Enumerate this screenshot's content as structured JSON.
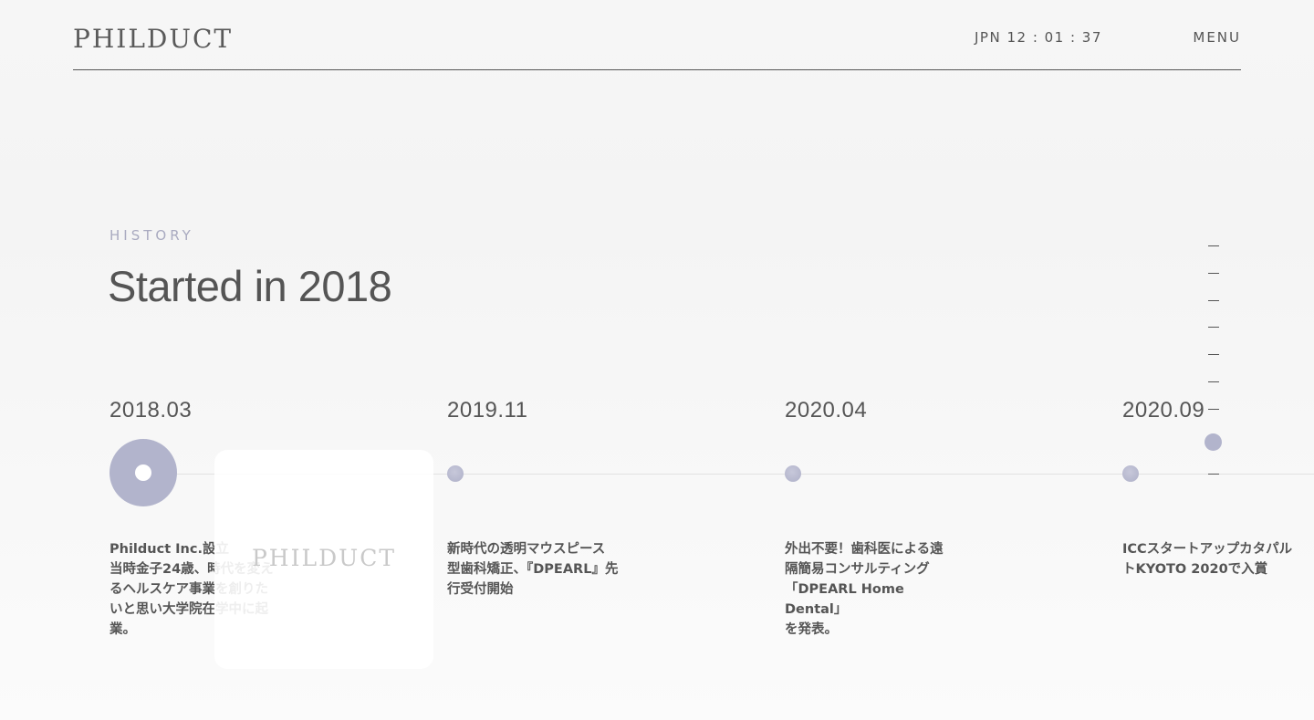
{
  "header": {
    "logo": "PHILDUCT",
    "clock": "JPN  12 : 01 : 37",
    "menu_label": "MENU"
  },
  "section": {
    "eyebrow": "HISTORY",
    "title": "Started in 2018"
  },
  "timeline": [
    {
      "date": "2018.03",
      "description": "Philduct Inc.設立\n当時金子24歳、時代を変え\nるヘルスケア事業を創りた\nいと思い大学院在学中に起\n業。",
      "active": true
    },
    {
      "date": "2019.11",
      "description": "新時代の透明マウスピース\n型歯科矯正、『DPEARL』先\n行受付開始",
      "active": false
    },
    {
      "date": "2020.04",
      "description": "外出不要！歯科医による遠\n隔簡易コンサルティング\n「DPEARL Home Dental」\nを発表。",
      "active": false
    },
    {
      "date": "2020.09",
      "description": "ICCスタートアップカタパル\nトKYOTO 2020で入賞",
      "active": false
    }
  ],
  "card": {
    "logo": "PHILDUCT"
  },
  "colors": {
    "accent": "#b2b4cc",
    "text": "#555555",
    "eyebrow": "#a9aac0"
  }
}
